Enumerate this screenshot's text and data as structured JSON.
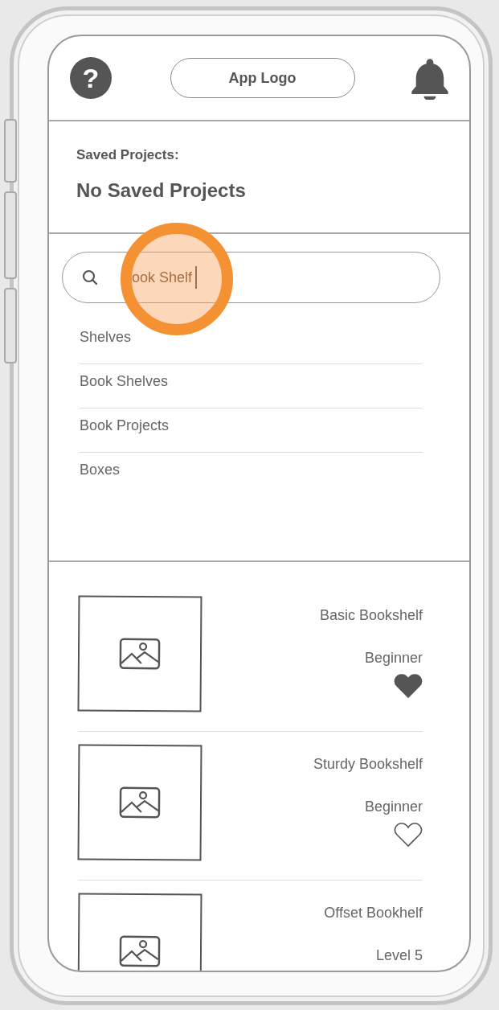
{
  "header": {
    "help_icon": "?",
    "logo": "App Logo"
  },
  "saved_projects": {
    "label": "Saved Projects:",
    "message": "No Saved Projects"
  },
  "search": {
    "value": "ook Shelf"
  },
  "suggestions": [
    {
      "label": "Shelves"
    },
    {
      "label": "Book Shelves"
    },
    {
      "label": "Book Projects"
    },
    {
      "label": "Boxes"
    }
  ],
  "projects": [
    {
      "name": "Basic Bookshelf",
      "level": "Beginner",
      "favorite": true
    },
    {
      "name": "Sturdy Bookshelf",
      "level": "Beginner",
      "favorite": false
    },
    {
      "name": "Offset Bookhelf",
      "level": "Level 5"
    }
  ]
}
